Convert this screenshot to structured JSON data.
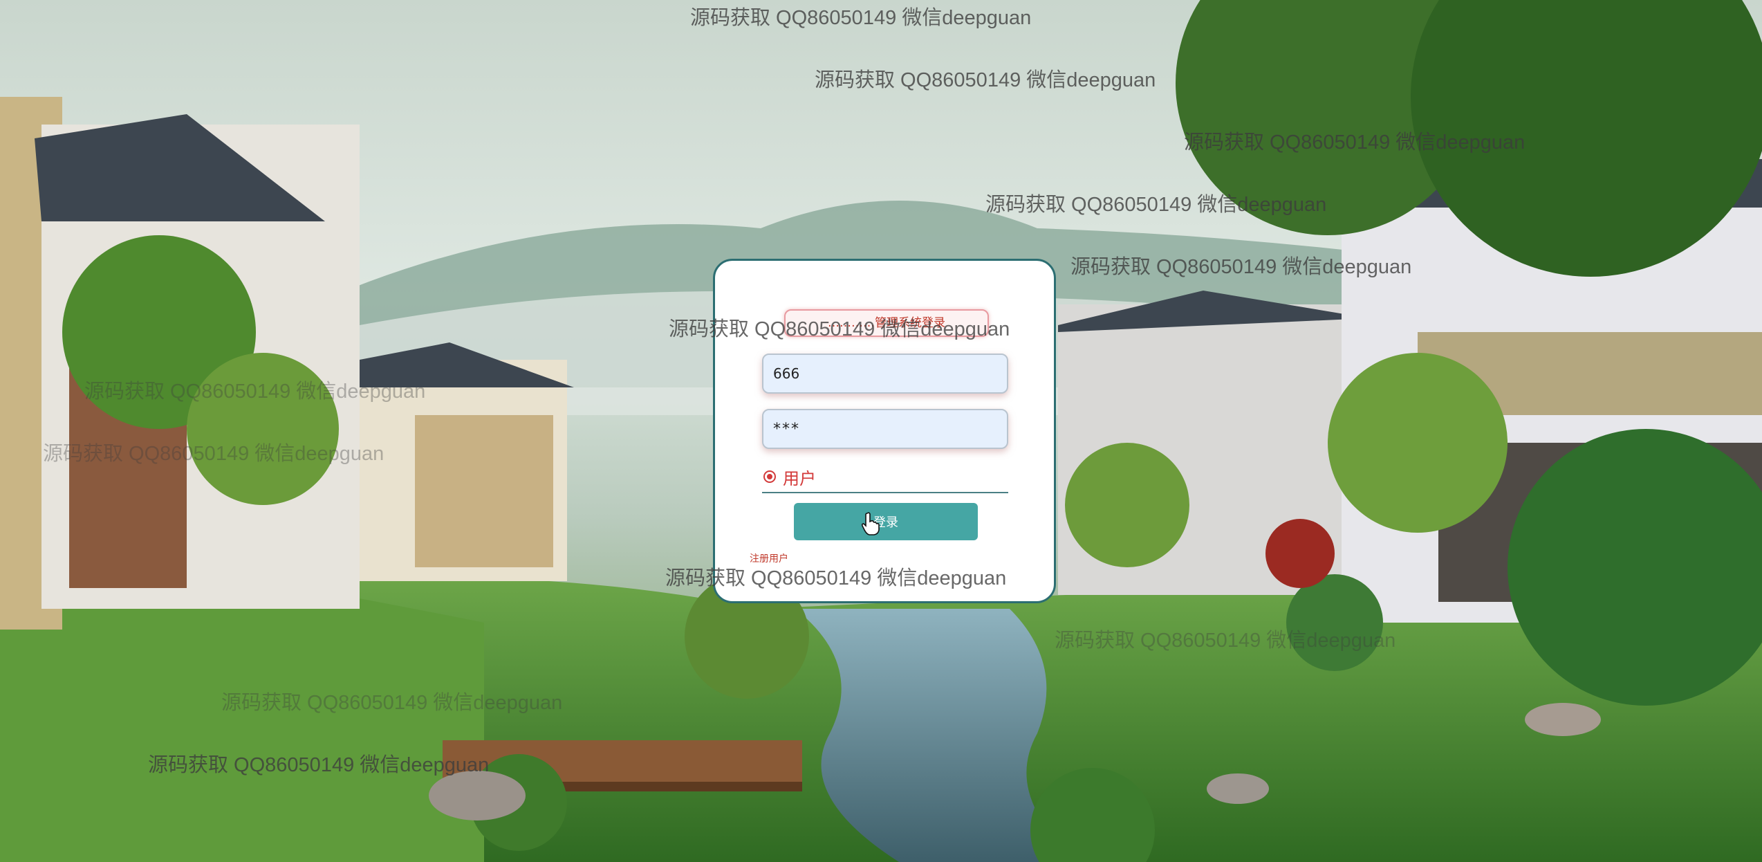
{
  "login": {
    "title": "…………管理系统登录",
    "username_value": "666",
    "password_value": "***",
    "role_label": "用户",
    "login_button": "登录",
    "register_link": "注册用户"
  },
  "watermarks": {
    "w1": "源码获取 QQ86050149 微信deepguan",
    "w2": "源码获取 QQ86050149 微信deepguan",
    "w3": "源码获取 QQ86050149 微信deepguan",
    "w4": "源码获取 QQ86050149 微信deepguan",
    "w5": "源码获取 QQ86050149 微信deepguan",
    "w6": "源码获取 QQ86050149 微信deepguan",
    "w7": "源码获取 QQ86050149 微信deepguan",
    "w8": "源码获取 QQ86050149 微信deepguan",
    "w9": "源码获取 QQ86050149 微信deepguan",
    "w10": "源码获取 QQ86050149 微信deepguan",
    "w11": "源码获取 QQ86050149 微信deepguan",
    "w12": "源码获取 QQ86050149 微信deepguan"
  },
  "icons": {
    "cursor": "hand-pointer-icon",
    "radio": "radio-selected-icon"
  },
  "colors": {
    "card_border": "#2c6e72",
    "button": "#45a6a4",
    "accent_red": "#d33a3a",
    "input_bg": "#e6f0fd"
  }
}
